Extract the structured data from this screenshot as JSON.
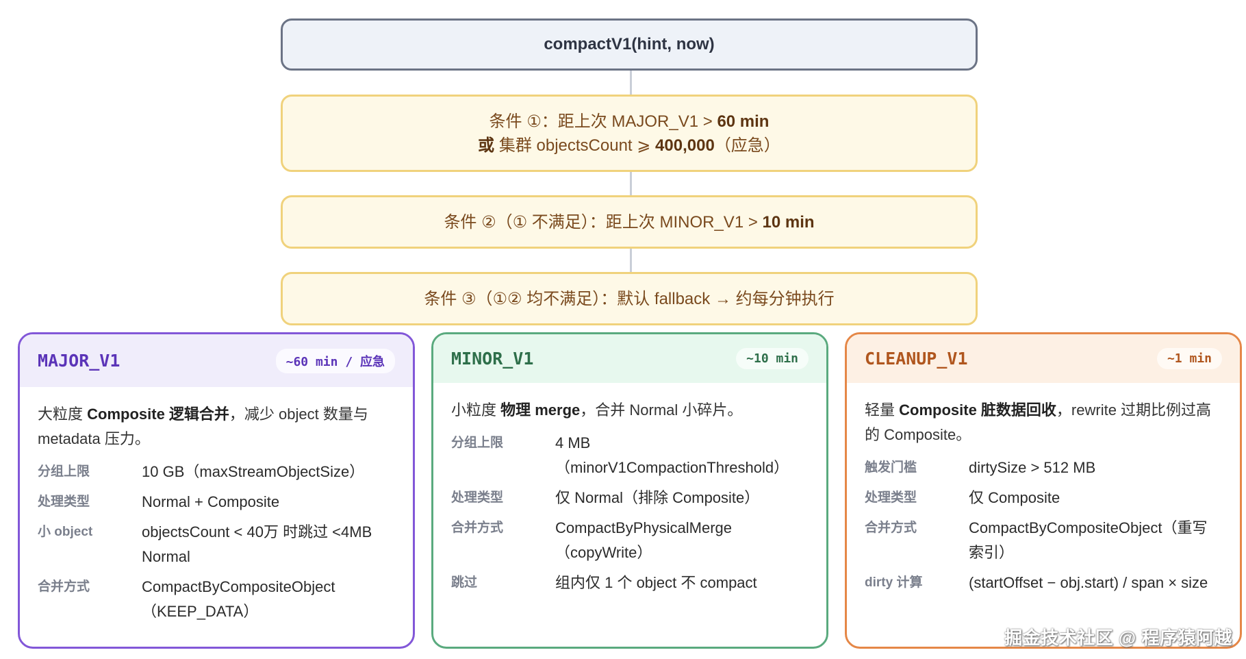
{
  "root": {
    "label": "compactV1(hint, now)"
  },
  "conditions": [
    {
      "pre": "条件 ①：距上次 MAJOR_V1 > ",
      "strong": "60 min",
      "line2_strong_a": "或",
      "line2_mid": " 集群 objectsCount ⩾ ",
      "line2_strong_b": "400,000",
      "line2_post": "（应急）"
    },
    {
      "pre": "条件 ②（① 不满足）：距上次 MINOR_V1 > ",
      "strong": "10 min"
    },
    {
      "text": "条件 ③（①② 均不满足）：默认 fallback → 约每分钟执行"
    }
  ],
  "cards": {
    "major": {
      "title": "MAJOR_V1",
      "badge": "~60 min / 应急",
      "desc_pre": "大粒度 ",
      "desc_strong": "Composite 逻辑合并",
      "desc_post": "，减少 object 数量与 metadata 压力。",
      "rows": [
        {
          "label": "分组上限",
          "value": "10 GB（maxStreamObjectSize）"
        },
        {
          "label": "处理类型",
          "value": "Normal + Composite"
        },
        {
          "label": "小 object",
          "value": "objectsCount < 40万 时跳过 <4MB Normal"
        },
        {
          "label": "合并方式",
          "value": "CompactByCompositeObject（KEEP_DATA）"
        }
      ]
    },
    "minor": {
      "title": "MINOR_V1",
      "badge": "~10 min",
      "desc_pre": "小粒度 ",
      "desc_strong": "物理 merge",
      "desc_post": "，合并 Normal 小碎片。",
      "rows": [
        {
          "label": "分组上限",
          "value": "4 MB（minorV1CompactionThreshold）"
        },
        {
          "label": "处理类型",
          "value": "仅 Normal（排除 Composite）"
        },
        {
          "label": "合并方式",
          "value": "CompactByPhysicalMerge（copyWrite）"
        },
        {
          "label": "跳过",
          "value": "组内仅 1 个 object 不 compact"
        }
      ]
    },
    "cleanup": {
      "title": "CLEANUP_V1",
      "badge": "~1 min",
      "desc_pre": "轻量 ",
      "desc_strong": "Composite 脏数据回收",
      "desc_post": "，rewrite 过期比例过高的 Composite。",
      "rows": [
        {
          "label": "触发门槛",
          "value": "dirtySize > 512 MB"
        },
        {
          "label": "处理类型",
          "value": "仅 Composite"
        },
        {
          "label": "合并方式",
          "value": "CompactByCompositeObject（重写索引）"
        },
        {
          "label": "dirty 计算",
          "value": "(startOffset − obj.start) / span × size"
        }
      ]
    }
  },
  "watermark": "掘金技术社区 @ 程序猿阿越"
}
